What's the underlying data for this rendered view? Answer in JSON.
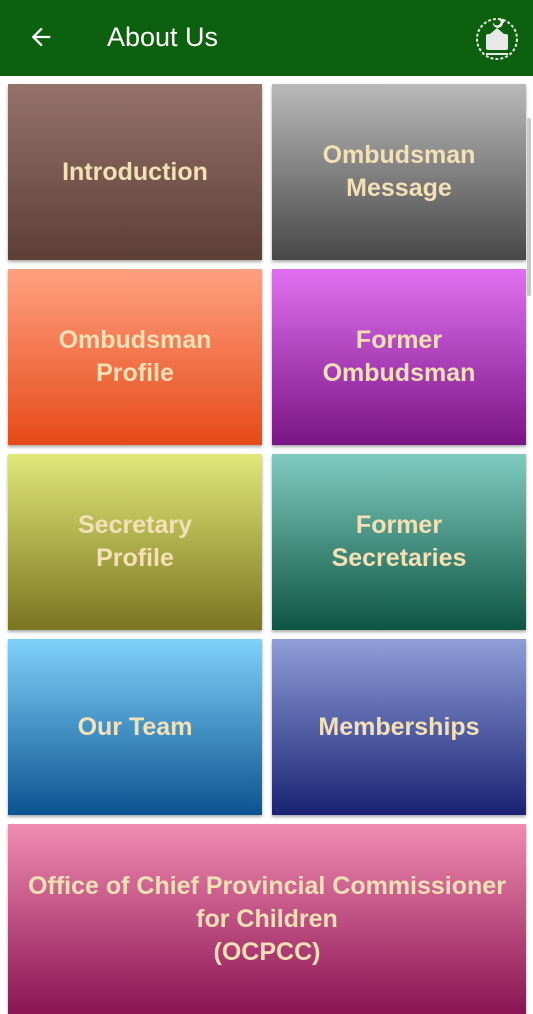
{
  "appbar": {
    "title": "About Us",
    "back_icon": "arrow-left-icon",
    "emblem_icon": "government-emblem-icon",
    "background": "#0d600d"
  },
  "tiles": [
    {
      "lines": [
        "Introduction"
      ]
    },
    {
      "lines": [
        "Ombudsman",
        "Message"
      ]
    },
    {
      "lines": [
        "Ombudsman",
        "Profile"
      ]
    },
    {
      "lines": [
        "Former",
        "Ombudsman"
      ]
    },
    {
      "lines": [
        "Secretary",
        "Profile"
      ]
    },
    {
      "lines": [
        "Former",
        "Secretaries"
      ]
    },
    {
      "lines": [
        "Our Team"
      ]
    },
    {
      "lines": [
        "Memberships"
      ]
    },
    {
      "lines": [
        "Office of Chief Provincial Commissioner",
        "for Children",
        "(OCPCC)"
      ]
    }
  ],
  "colors": {
    "tile_text": "#f3e0b5"
  }
}
